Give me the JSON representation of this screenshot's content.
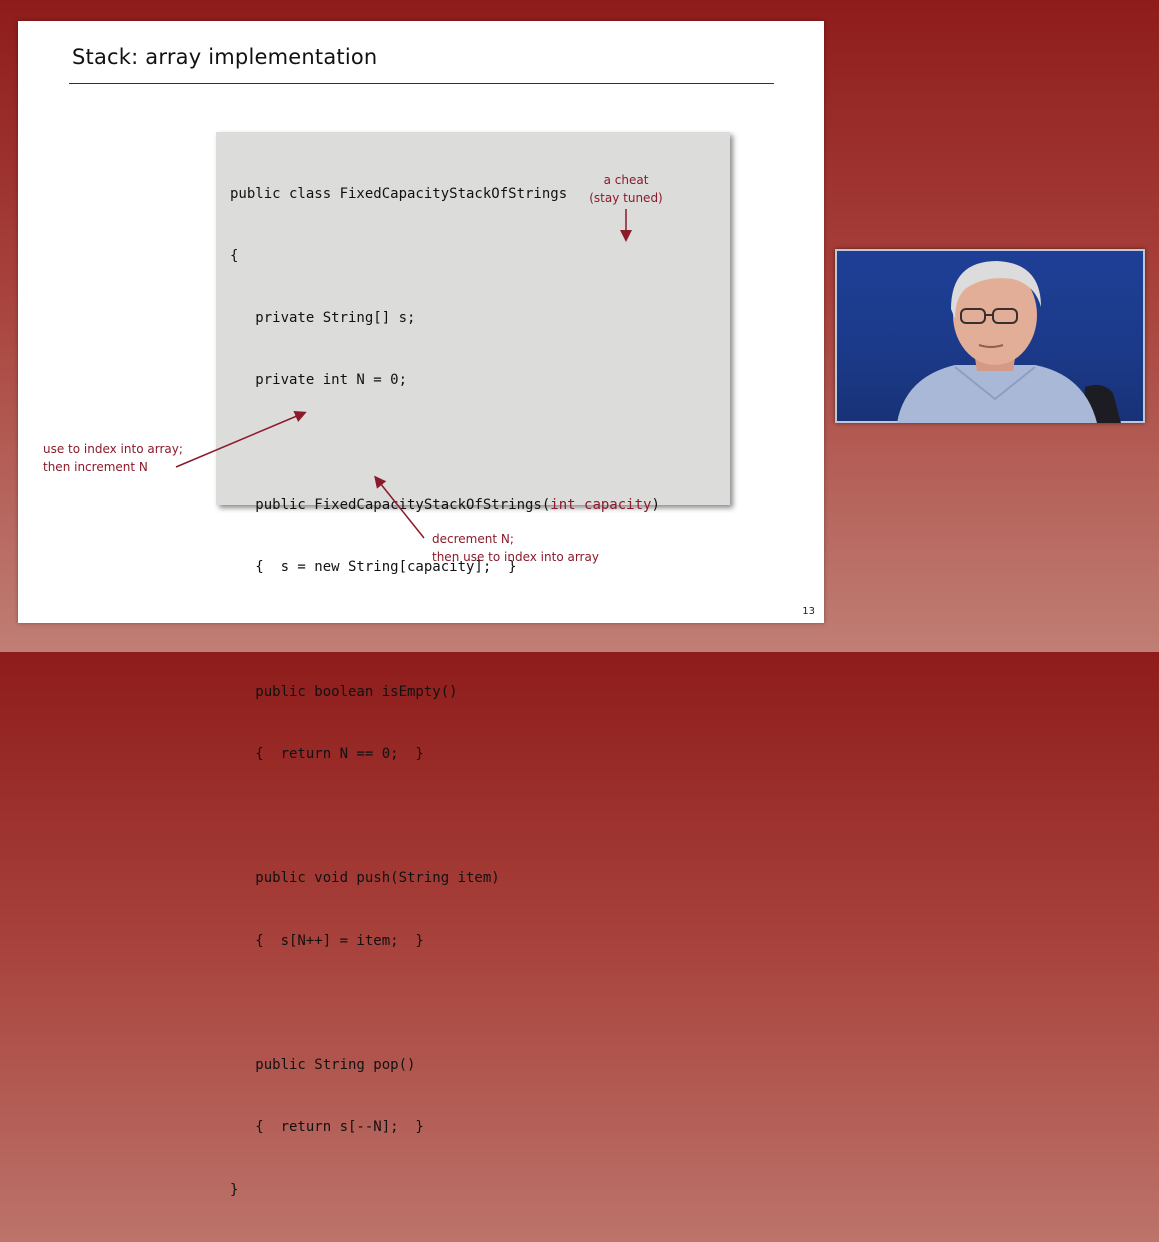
{
  "slide": {
    "title": "Stack:  array implementation",
    "page_number": "13"
  },
  "code": {
    "lines": [
      "public class FixedCapacityStackOfStrings",
      "{",
      "   private String[] s;",
      "   private int N = 0;",
      "",
      "   public FixedCapacityStackOfStrings(",
      "   {  s = new String[capacity];  }",
      "",
      "   public boolean isEmpty()",
      "   {  return N == 0;  }",
      "",
      "   public void push(String item)",
      "   {  s[N++] = item;  }",
      "",
      "   public String pop()",
      "   {  return s[--N];  }",
      "}"
    ],
    "highlight_param": "int capacity",
    "closing_paren": ")"
  },
  "annotations": {
    "cheat_line1": "a cheat",
    "cheat_line2": "(stay tuned)",
    "push_line1": "use to index into array;",
    "push_line2": "then increment N",
    "pop_line1": "decrement N;",
    "pop_line2": "then use to index into array"
  },
  "colors": {
    "annotation": "#8b1a2b",
    "code_background": "#dcdcda",
    "page_background": "#a8423c"
  },
  "video": {
    "content": "presenter-webcam"
  }
}
